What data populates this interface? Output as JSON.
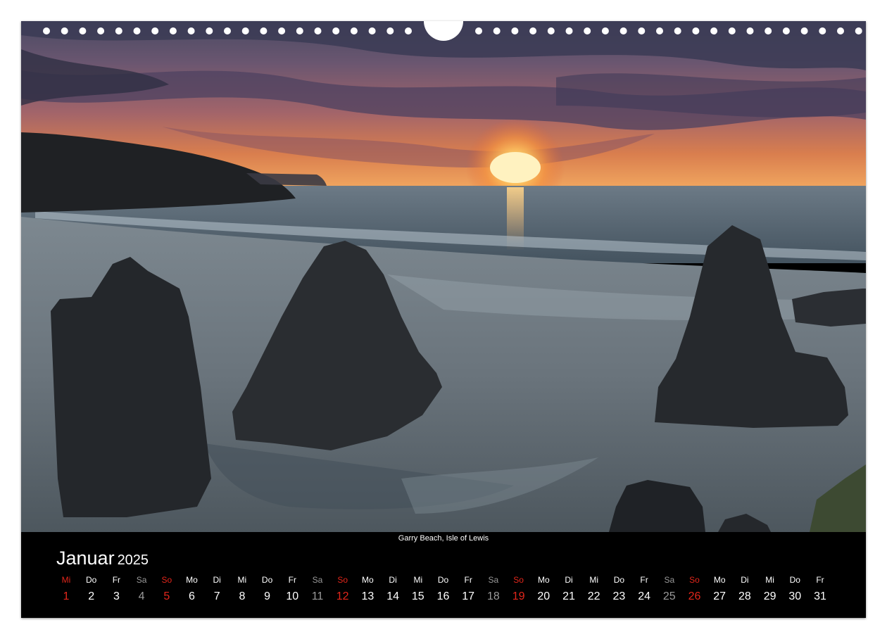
{
  "photo": {
    "caption": "Garry Beach, Isle of Lewis",
    "description_icon": "sea-stacks-sunset-photo"
  },
  "calendar": {
    "month": "Januar",
    "year": "2025",
    "colors": {
      "weekday": "#ffffff",
      "saturday": "#9a9a9a",
      "sunday": "#e3261b",
      "background": "#000000"
    },
    "days": [
      {
        "name": "Mi",
        "num": "1",
        "type": "holiday"
      },
      {
        "name": "Do",
        "num": "2",
        "type": "weekday"
      },
      {
        "name": "Fr",
        "num": "3",
        "type": "weekday"
      },
      {
        "name": "Sa",
        "num": "4",
        "type": "sat"
      },
      {
        "name": "So",
        "num": "5",
        "type": "sun"
      },
      {
        "name": "Mo",
        "num": "6",
        "type": "weekday"
      },
      {
        "name": "Di",
        "num": "7",
        "type": "weekday"
      },
      {
        "name": "Mi",
        "num": "8",
        "type": "weekday"
      },
      {
        "name": "Do",
        "num": "9",
        "type": "weekday"
      },
      {
        "name": "Fr",
        "num": "10",
        "type": "weekday"
      },
      {
        "name": "Sa",
        "num": "11",
        "type": "sat"
      },
      {
        "name": "So",
        "num": "12",
        "type": "sun"
      },
      {
        "name": "Mo",
        "num": "13",
        "type": "weekday"
      },
      {
        "name": "Di",
        "num": "14",
        "type": "weekday"
      },
      {
        "name": "Mi",
        "num": "15",
        "type": "weekday"
      },
      {
        "name": "Do",
        "num": "16",
        "type": "weekday"
      },
      {
        "name": "Fr",
        "num": "17",
        "type": "weekday"
      },
      {
        "name": "Sa",
        "num": "18",
        "type": "sat"
      },
      {
        "name": "So",
        "num": "19",
        "type": "sun"
      },
      {
        "name": "Mo",
        "num": "20",
        "type": "weekday"
      },
      {
        "name": "Di",
        "num": "21",
        "type": "weekday"
      },
      {
        "name": "Mi",
        "num": "22",
        "type": "weekday"
      },
      {
        "name": "Do",
        "num": "23",
        "type": "weekday"
      },
      {
        "name": "Fr",
        "num": "24",
        "type": "weekday"
      },
      {
        "name": "Sa",
        "num": "25",
        "type": "sat"
      },
      {
        "name": "So",
        "num": "26",
        "type": "sun"
      },
      {
        "name": "Mo",
        "num": "27",
        "type": "weekday"
      },
      {
        "name": "Di",
        "num": "28",
        "type": "weekday"
      },
      {
        "name": "Mi",
        "num": "29",
        "type": "weekday"
      },
      {
        "name": "Do",
        "num": "30",
        "type": "weekday"
      },
      {
        "name": "Fr",
        "num": "31",
        "type": "weekday"
      }
    ]
  }
}
